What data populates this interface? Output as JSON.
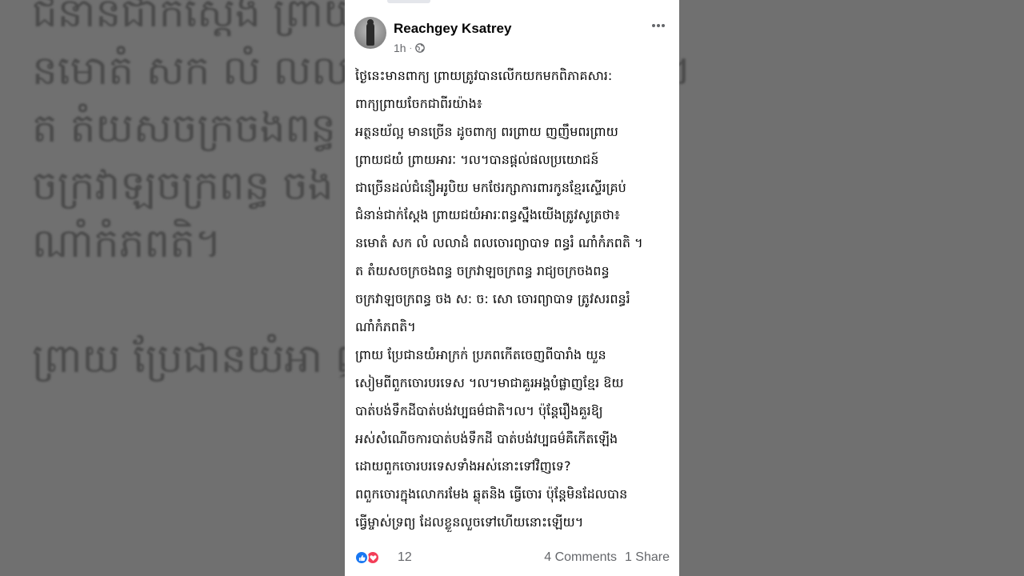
{
  "background_lines": [
    "ជំនាន់ជាក់ស្តែង ព្រាយ          យើងត្រូវសូត្រថា៖",
    "នមោតំ សក លំ លលា          ទ ពន្ធរំ ណាំកំភពតិ ។",
    "ត តំយសចក្រចងពន្ធ            ជ្យចក្រចងពន្ធ",
    "ចក្រវាឡចក្រពន្ធ ចង          ព្យាបាទ ត្រូវសរពន្ធរំ",
    "ណាំកំភពតិ។",
    "",
    "ព្រាយ ប្រែជានយំអា          ញពីបារាំង យួន"
  ],
  "post": {
    "author": "Reachgey Ksatrey",
    "time": "1h",
    "dot": "·",
    "body_lines": [
      "ថ្ងៃនេះមានពាក្យ ព្រាយត្រូវបានលើកយកមកពិភាគសារ:",
      "ពាក្យព្រាយចែកជាពីរយ៉ាង៖",
      "អត្ថនយ័ល្អ មានច្រើន ដូចពាក្យ ពរព្រាយ ញញឹមពរព្រាយ",
      "ព្រាយជយំ ព្រាយអារៈ ។ល។បានផ្តល់ផលប្រយោជន៍",
      "ជាច្រើនដល់ជំនឿអរូបិយ មកថែរក្សាការពារកូនខ្មែរស្ទើរគ្រប់",
      "ជំនាន់ជាក់ស្តែង ព្រាយជយំអារៈពន្ធស្នឹងយើងត្រូវសូត្រថា៖",
      "នមោតំ សក លំ លលាដំ ពលចោរព្យាបាទ ពន្ធរំ ណាំកំភពតិ ។",
      "ត តំយសចក្រចងពន្ធ ចក្រវាឡចក្រពន្ធ រាជ្យចក្រចងពន្ធ",
      "ចក្រវាឡចក្រពន្ធ ចង ស: ច: សោ ចោរព្យាបាទ ត្រូវសរពន្ធរំ",
      "ណាំកំភពតិ។",
      "ព្រាយ ប្រែជានយំអាក្រក់ ប្រភពកើតចេញពីបារាំង យួន",
      "សៀមពីពួកចោរបរទេស ។ល។មាជាគួរអង្គបំផ្លាញខ្មែរ ឱយ",
      "បាត់បង់ទឹកដីបាត់បង់វប្បធម៌ជាតិ។ល។ ប៉ុន្តែរឿងគួរឱ្យ",
      "អស់សំណើចការបាត់បង់ទឹកដី បាត់បង់វប្បធម៌គឺកើតឡើង",
      "ដោយពួកចោរបរទេសទាំងអស់នោះទៅវិញទេ?",
      "ពពួកចោរក្នុងលោករមែង ឆ្លុតនិង ធ្វើចោរ ប៉ុន្តែមិនដែលបាន",
      "ធ្វើម្ចាស់ទ្រព្យ ដែលខ្លួនលួចទៅហើយនោះឡើយ។"
    ],
    "reactions": {
      "count": "12",
      "like_icon": "like-icon",
      "love_icon": "love-icon"
    },
    "comments": "4 Comments",
    "shares": "1 Share"
  },
  "colors": {
    "author": "#050505",
    "meta": "#65676b",
    "like": "#1877f2",
    "love": "#f33e58"
  }
}
